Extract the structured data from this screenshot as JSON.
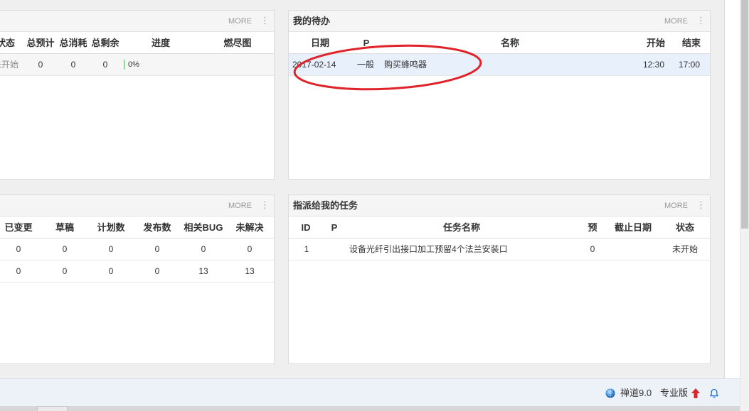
{
  "colors": {
    "page_bg": "#efefef",
    "todo_row_highlight": "#e8f0fb",
    "project_row_highlight": "#f6f6f6",
    "progress_green": "#5cb85c",
    "footer_bg": "#edf2f9",
    "annotation_red": "#e0232b",
    "upgrade_red": "#d9262b",
    "bell_blue": "#1f72d6"
  },
  "icons": {
    "more_menu": "more-vertical-icon",
    "footer_logo": "globe-icon",
    "footer_upgrade": "arrow-up-icon",
    "footer_notify": "bell-icon"
  },
  "project_block": {
    "more_label": "MORE",
    "columns": [
      "状态",
      "总预计",
      "总消耗",
      "总剩余",
      "进度",
      "燃尽图"
    ],
    "rows": [
      {
        "status": "未开始",
        "estimate": "0",
        "consumed": "0",
        "left": "0",
        "progress": "0%"
      }
    ]
  },
  "todo_block": {
    "title": "我的待办",
    "more_label": "MORE",
    "columns": [
      "日期",
      "P",
      "名称",
      "开始",
      "结束"
    ],
    "rows": [
      {
        "date": "2017-02-14",
        "pri": "一般",
        "name": "购买蜂鸣器",
        "begin": "12:30",
        "end": "17:00"
      }
    ]
  },
  "product_block": {
    "more_label": "MORE",
    "columns": [
      "已变更",
      "草稿",
      "计划数",
      "发布数",
      "相关BUG",
      "未解决"
    ],
    "rows": [
      [
        "0",
        "0",
        "0",
        "0",
        "0",
        "0"
      ],
      [
        "0",
        "0",
        "0",
        "0",
        "13",
        "13"
      ]
    ]
  },
  "task_block": {
    "title": "指派给我的任务",
    "more_label": "MORE",
    "columns": [
      "ID",
      "P",
      "任务名称",
      "预",
      "截止日期",
      "状态"
    ],
    "rows": [
      {
        "id": "1",
        "name": "设备光纤引出接口加工预留4个法兰安装口",
        "estimate": "0",
        "status": "未开始"
      }
    ]
  },
  "footer": {
    "version_label": "禅道9.0",
    "edition_label": "专业版"
  }
}
